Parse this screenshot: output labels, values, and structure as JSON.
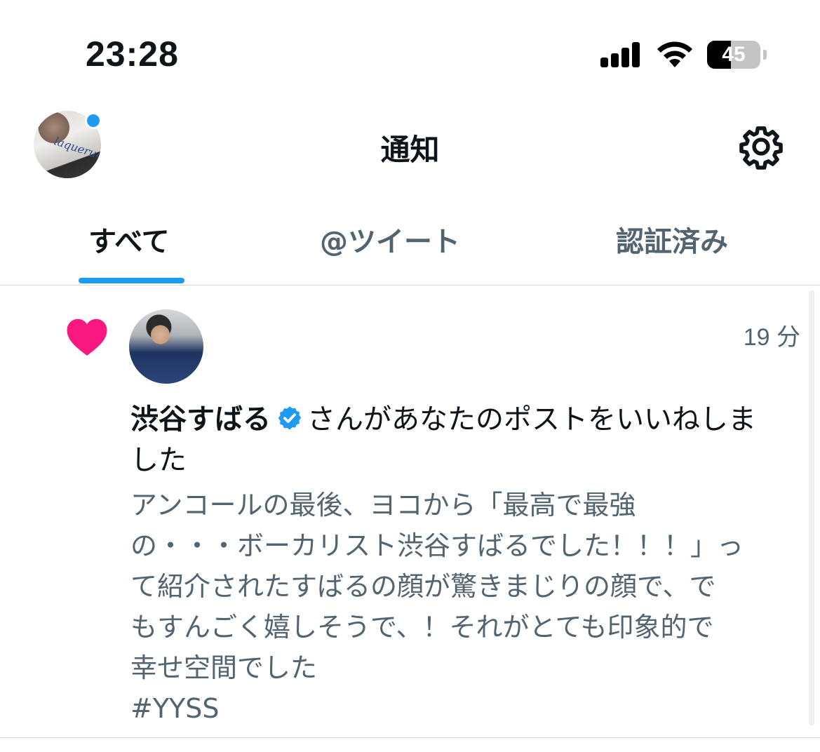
{
  "status_bar": {
    "time": "23:28",
    "battery_percent": "45",
    "battery_level": 0.45
  },
  "header": {
    "title": "通知",
    "avatar_shirt_text": "laquerue"
  },
  "tabs": [
    {
      "label": "すべて",
      "active": true
    },
    {
      "label": "@ツイート",
      "active": false
    },
    {
      "label": "認証済み",
      "active": false
    }
  ],
  "notification": {
    "type_icon": "heart-icon",
    "time_ago": "19 分",
    "user_name": "渋谷すばる",
    "action_text": "さんがあなたのポストをいいねしました",
    "action_line1": "さんがあなたのポストをいいねしま",
    "action_line2": "した",
    "tweet_lines": [
      "アンコールの最後、ヨコから「最高で最強",
      "の・・・ボーカリスト渋谷すばるでした！！！」っ",
      "て紹介されたすばるの顔が驚きまじりの顔で、で",
      "もすんごく嬉しそうで、！それがとても印象的で",
      "幸せ空間でした",
      "#YYSS"
    ]
  },
  "colors": {
    "accent": "#1d9bf0",
    "heart": "#f91880",
    "secondary_text": "#536471",
    "primary_text": "#0f1419"
  }
}
